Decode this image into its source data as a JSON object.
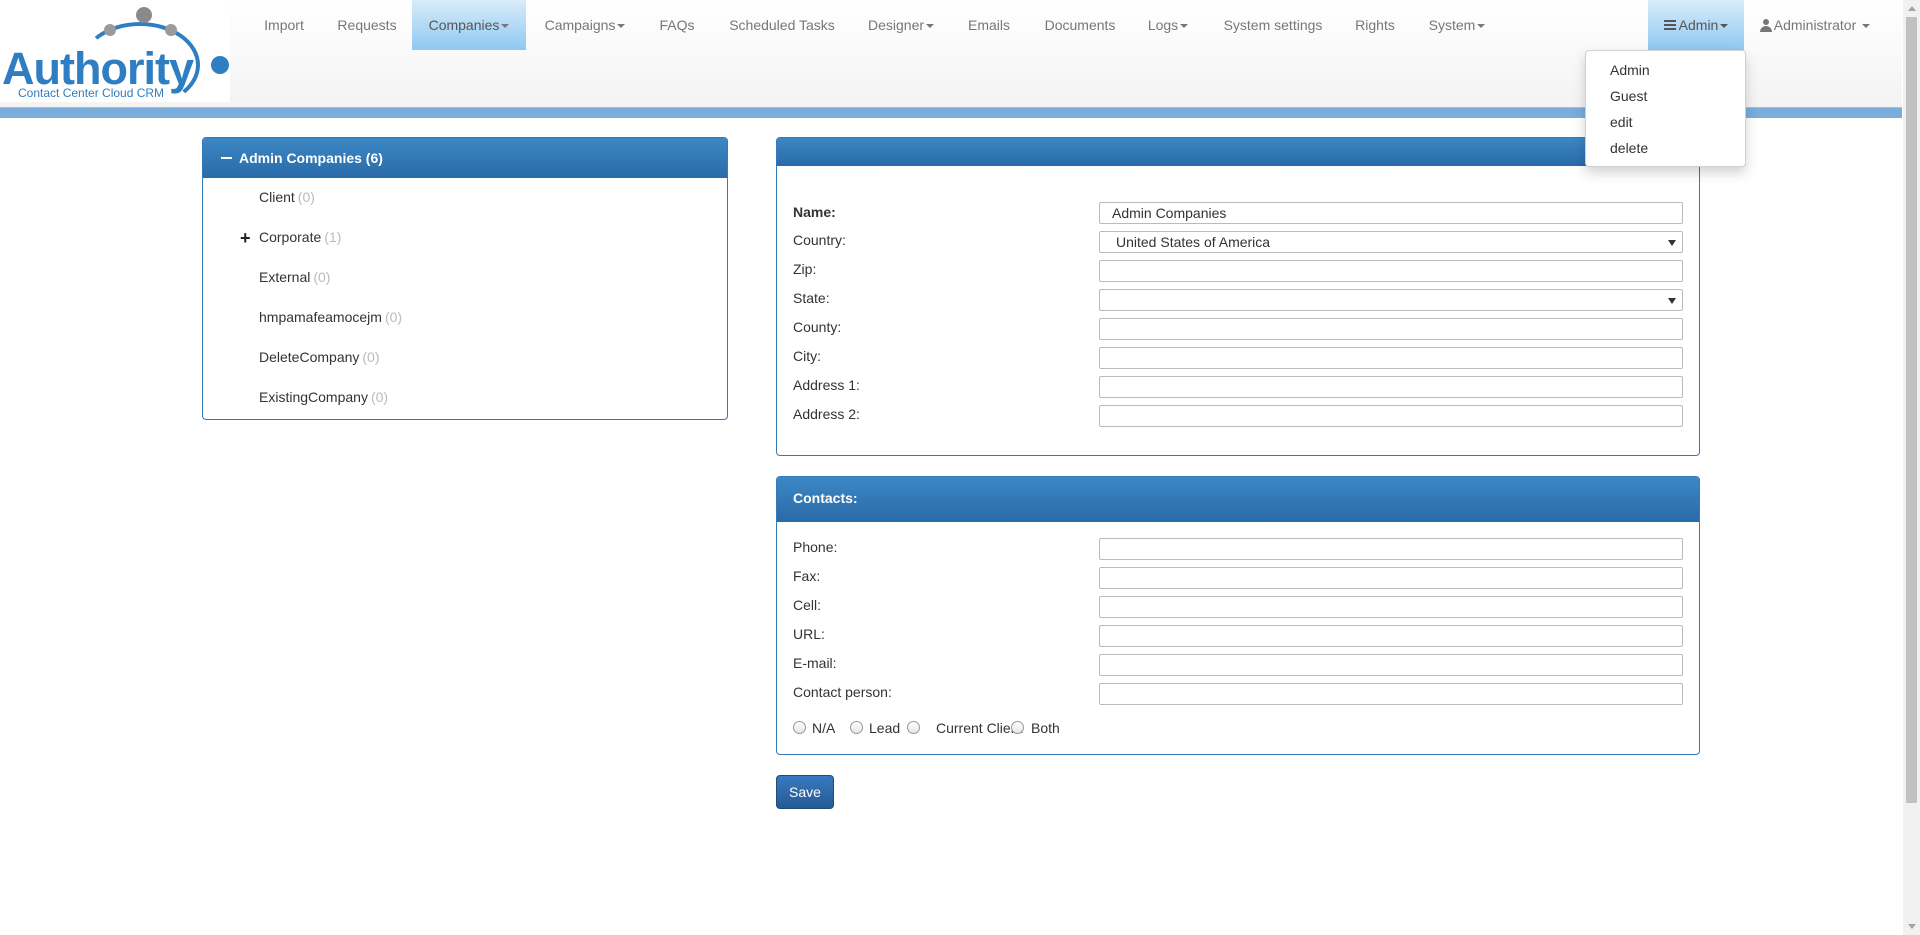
{
  "logo": {
    "word": "Authority",
    "tagline": "Contact Center Cloud CRM"
  },
  "nav": {
    "items": [
      {
        "label": "Import",
        "dropdown": false
      },
      {
        "label": "Requests",
        "dropdown": false
      },
      {
        "label": "Companies",
        "dropdown": true,
        "active": true
      },
      {
        "label": "Campaigns",
        "dropdown": true
      },
      {
        "label": "FAQs",
        "dropdown": false
      },
      {
        "label": "Scheduled Tasks",
        "dropdown": false
      },
      {
        "label": "Designer",
        "dropdown": true
      },
      {
        "label": "Emails",
        "dropdown": false
      },
      {
        "label": "Documents",
        "dropdown": false
      },
      {
        "label": "Logs",
        "dropdown": true
      },
      {
        "label": "System settings",
        "dropdown": false
      },
      {
        "label": "Rights",
        "dropdown": false
      },
      {
        "label": "System",
        "dropdown": true
      }
    ],
    "role_menu": {
      "label": "Admin",
      "icon": "list-icon"
    },
    "user_menu": {
      "label": "Administrator",
      "icon": "user-icon"
    }
  },
  "role_dropdown": {
    "items": [
      "Admin",
      "Guest",
      "edit",
      "delete"
    ]
  },
  "tree": {
    "title": "Admin Companies (6)",
    "items": [
      {
        "name": "Client",
        "count": "(0)",
        "expandable": false
      },
      {
        "name": "Corporate",
        "count": "(1)",
        "expandable": true
      },
      {
        "name": "External",
        "count": "(0)",
        "expandable": false
      },
      {
        "name": "hmpamafeamocejm",
        "count": "(0)",
        "expandable": false
      },
      {
        "name": "DeleteCompany",
        "count": "(0)",
        "expandable": false
      },
      {
        "name": "ExistingCompany",
        "count": "(0)",
        "expandable": false
      }
    ]
  },
  "form": {
    "name_label": "Name:",
    "name_value": "Admin Companies",
    "country_label": "Country:",
    "country_value": "United States of America",
    "zip_label": "Zip:",
    "state_label": "State:",
    "state_value": "",
    "county_label": "County:",
    "city_label": "City:",
    "address1_label": "Address 1:",
    "address2_label": "Address 2:"
  },
  "contacts": {
    "title": "Contacts:",
    "phone_label": "Phone:",
    "fax_label": "Fax:",
    "cell_label": "Cell:",
    "url_label": "URL:",
    "email_label": "E-mail:",
    "contact_person_label": "Contact person:",
    "radio_options": [
      "N/A",
      "Lead",
      "Current Client",
      "Both"
    ]
  },
  "save_label": "Save",
  "colors": {
    "primary": "#337ab7",
    "header_bar": "#7aacdc",
    "active_nav": "#8ec8f1"
  }
}
